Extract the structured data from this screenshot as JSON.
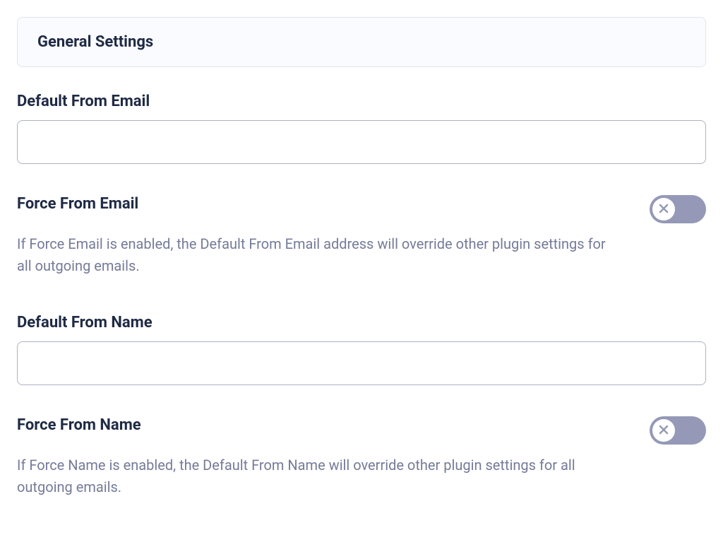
{
  "section": {
    "title": "General Settings"
  },
  "fields": {
    "default_from_email": {
      "label": "Default From Email",
      "value": ""
    },
    "force_from_email": {
      "label": "Force From Email",
      "help": "If Force Email is enabled, the Default From Email address will override other plugin settings for all outgoing emails.",
      "enabled": false
    },
    "default_from_name": {
      "label": "Default From Name",
      "value": ""
    },
    "force_from_name": {
      "label": "Force From Name",
      "help": "If Force Name is enabled, the Default From Name will override other plugin settings for all outgoing emails.",
      "enabled": false
    }
  }
}
